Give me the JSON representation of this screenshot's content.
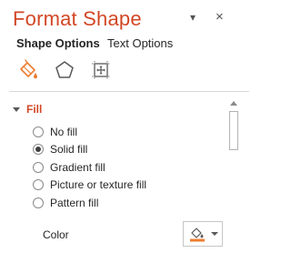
{
  "pane": {
    "title": "Format Shape",
    "menu_glyph": "▾",
    "close_glyph": "×"
  },
  "tabs": [
    {
      "label": "Shape Options",
      "active": true
    },
    {
      "label": "Text Options",
      "active": false
    }
  ],
  "icon_tabs": [
    {
      "name": "fill-line-icon",
      "active": true
    },
    {
      "name": "effects-icon",
      "active": false
    },
    {
      "name": "size-properties-icon",
      "active": false
    }
  ],
  "fill": {
    "section_label": "Fill",
    "expanded": true,
    "options": [
      {
        "label": "No fill",
        "selected": false
      },
      {
        "label": "Solid fill",
        "selected": true
      },
      {
        "label": "Gradient fill",
        "selected": false
      },
      {
        "label": "Picture or texture fill",
        "selected": false
      },
      {
        "label": "Pattern fill",
        "selected": false
      }
    ],
    "color_label": "Color",
    "color_value": "#ed7d31"
  },
  "colors": {
    "accent": "#d24726",
    "fill_color": "#ed7d31"
  }
}
